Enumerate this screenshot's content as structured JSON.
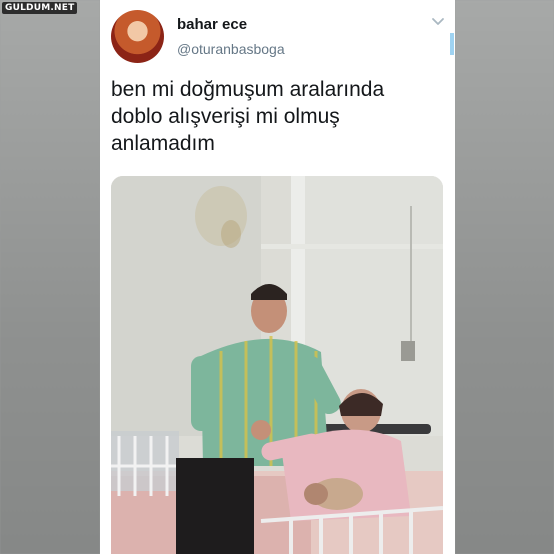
{
  "watermark": "GULDUM.NET",
  "tweet": {
    "display_name": "bahar ece",
    "handle": "@oturanbasboga",
    "text_lines": [
      "ben mi doğmuşum aralarında",
      "doblo alışverişi mi olmuş",
      "anlamadım"
    ]
  },
  "icons": {
    "menu": "chevron-down-icon"
  },
  "colors": {
    "name": "#14171a",
    "handle": "#657786",
    "scroll_accent": "#9fd3f2",
    "card_bg": "#ffffff"
  }
}
